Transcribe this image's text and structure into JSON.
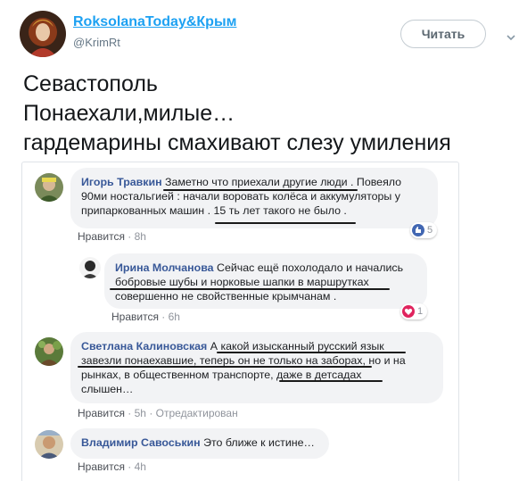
{
  "tweet": {
    "author_name": "RoksolanaToday&Крым",
    "author_handle": "@KrimRt",
    "follow_label": "Читать",
    "text_lines": [
      "Севастополь",
      "Понаехали,милые…",
      "гардемарины смахивают слезу умиления"
    ]
  },
  "comments": [
    {
      "name": "Игорь Травкин",
      "lines": [
        " Заметно что приехали другие люди . Повеяло",
        "90ми ностальгией : начали воровать колёса и аккумуляторы у",
        "припаркованных машин . 15 ть лет такого не было ."
      ],
      "like_label": "Нравится",
      "time": "8h",
      "edited": "",
      "reaction_icon": "thumbs-up-icon",
      "reaction_count": "5"
    },
    {
      "name": "Ирина Молчанова",
      "lines": [
        " Сейчас ещё похолодало и начались",
        "бобровые шубы и норковые шапки в маршрутках",
        "совершенно не свойственные крымчанам ."
      ],
      "like_label": "Нравится",
      "time": "6h",
      "edited": "",
      "reaction_icon": "heart-icon",
      "reaction_count": "1"
    },
    {
      "name": "Светлана Калиновская",
      "lines": [
        " А какой изысканный русский язык",
        "завезли понаехавшие, теперь он не только на заборах, но и на",
        "рынках, в общественном транспорте, даже в детсадах",
        "слышен…"
      ],
      "like_label": "Нравится",
      "time": "5h",
      "edited": "Отредактирован",
      "reaction_icon": "",
      "reaction_count": ""
    },
    {
      "name": "Владимир Савоськин",
      "lines": [
        " Это ближе к истине…"
      ],
      "like_label": "Нравится",
      "time": "4h",
      "edited": "",
      "reaction_icon": "",
      "reaction_count": ""
    }
  ],
  "colors": {
    "handle_blue": "#1da1f2",
    "fb_name_blue": "#385898",
    "bubble_gray": "#f2f3f5",
    "like_blue": "#4267b2",
    "love_red": "#e0245e"
  }
}
